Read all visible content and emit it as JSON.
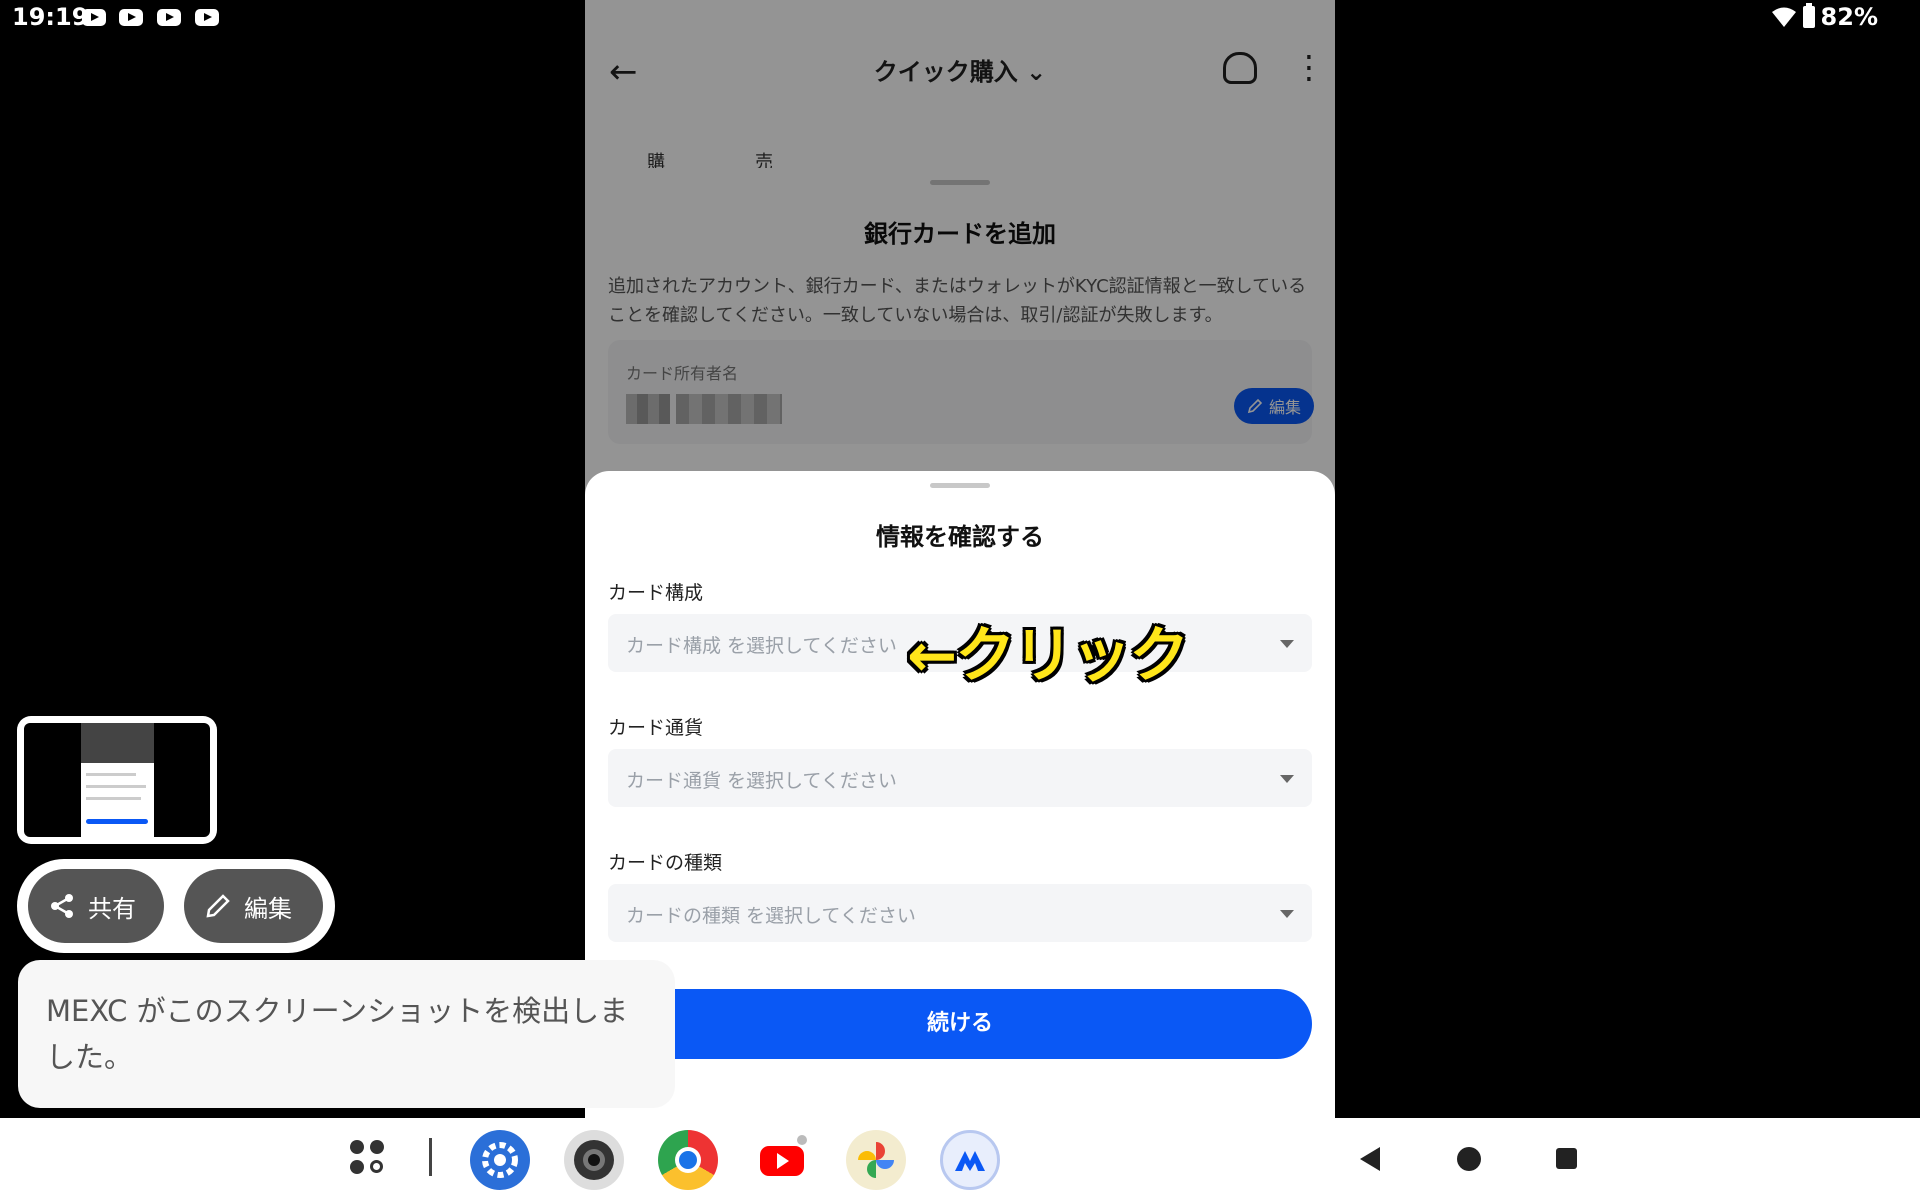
{
  "status_bar": {
    "time": "19:19",
    "battery": "82%",
    "notification_icons": [
      "youtube-icon",
      "youtube-icon",
      "youtube-icon",
      "youtube-icon"
    ]
  },
  "app_header": {
    "title": "クイック購入 ⌄"
  },
  "tabs": [
    "購入",
    "売却"
  ],
  "add_card_sheet": {
    "title": "銀行カードを追加",
    "description": "追加されたアカウント、銀行カード、またはウォレットがKYC認証情報と一致していることを確認してください。一致していない場合は、取引/認証が失敗します。",
    "holder_label": "カード所有者名",
    "edit_label": "編集"
  },
  "confirm_sheet": {
    "title": "情報を確認する",
    "fields": [
      {
        "label": "カード構成",
        "placeholder": "カード構成 を選択してください"
      },
      {
        "label": "カード通貨",
        "placeholder": "カード通貨 を選択してください"
      },
      {
        "label": "カードの種類",
        "placeholder": "カードの種類 を選択してください"
      }
    ],
    "annotation": "←クリック",
    "continue_label": "続ける"
  },
  "screenshot_overlay": {
    "share_label": "共有",
    "edit_label": "編集",
    "toast": "MEXC がこのスクリーンショットを検出しました。"
  },
  "taskbar": {
    "apps": [
      "app-search-icon",
      "settings-icon",
      "camera-icon",
      "chrome-icon",
      "youtube-icon",
      "photos-icon",
      "mexc-icon"
    ]
  },
  "colors": {
    "accent": "#0a58f5",
    "annotation": "#ffe61a"
  }
}
